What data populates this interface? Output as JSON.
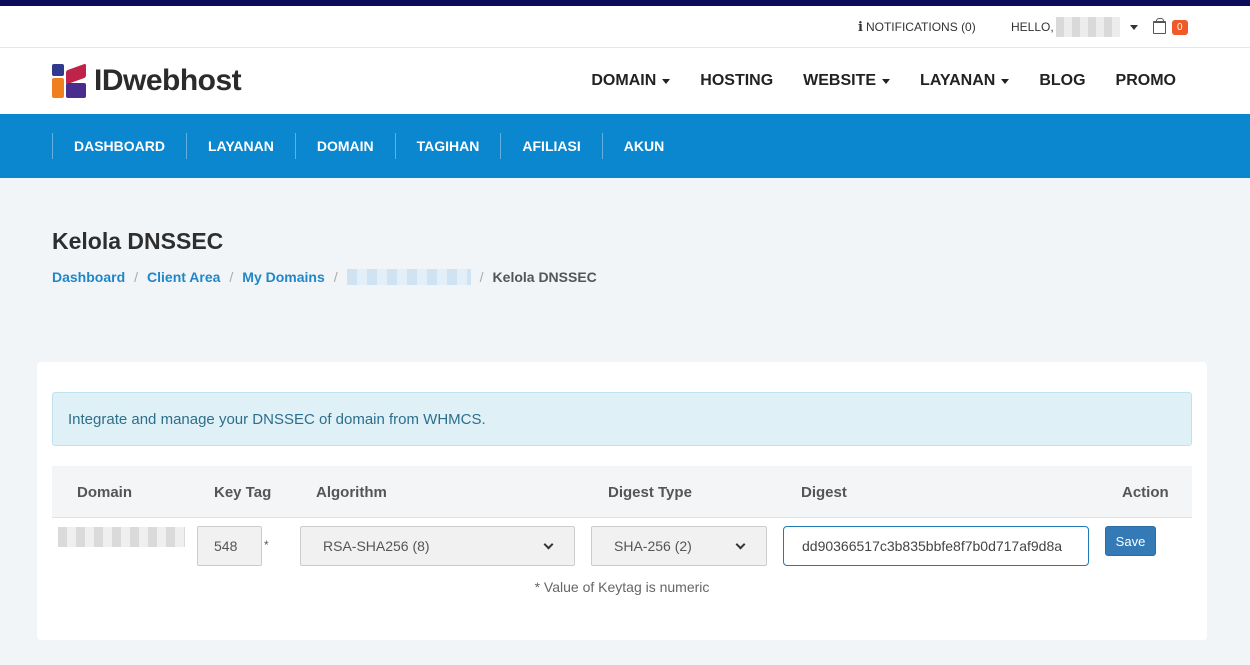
{
  "topbar": {
    "notifications_label": "NOTIFICATIONS (0)",
    "hello_label": "HELLO,",
    "cart_count": "0"
  },
  "brand": {
    "name": "IDwebhost"
  },
  "main_nav": [
    {
      "label": "DOMAIN",
      "dropdown": true
    },
    {
      "label": "HOSTING",
      "dropdown": false
    },
    {
      "label": "WEBSITE",
      "dropdown": true
    },
    {
      "label": "LAYANAN",
      "dropdown": true
    },
    {
      "label": "BLOG",
      "dropdown": false
    },
    {
      "label": "PROMO",
      "dropdown": false
    }
  ],
  "sub_nav": [
    "DASHBOARD",
    "LAYANAN",
    "DOMAIN",
    "TAGIHAN",
    "AFILIASI",
    "AKUN"
  ],
  "page": {
    "title": "Kelola DNSSEC",
    "breadcrumb": [
      "Dashboard",
      "Client Area",
      "My Domains"
    ],
    "breadcrumb_current": "Kelola DNSSEC"
  },
  "alert": {
    "text": "Integrate and manage your DNSSEC of domain from WHMCS."
  },
  "table": {
    "headers": {
      "domain": "Domain",
      "key_tag": "Key Tag",
      "algorithm": "Algorithm",
      "digest_type": "Digest Type",
      "digest": "Digest",
      "action": "Action"
    },
    "row": {
      "key_tag": "548",
      "asterisk": "*",
      "algorithm": "RSA-SHA256 (8)",
      "digest_type": "SHA-256 (2)",
      "digest": "dd90366517c3b835bbfe8f7b0d717af9d8a",
      "save_label": "Save"
    },
    "note": "* Value of Keytag is numeric"
  },
  "colors": {
    "top_strip": "#0b0d5c",
    "subnav_bg": "#0b87cf",
    "link": "#1f87c9",
    "badge": "#f05a28",
    "save_button": "#337ab7"
  }
}
